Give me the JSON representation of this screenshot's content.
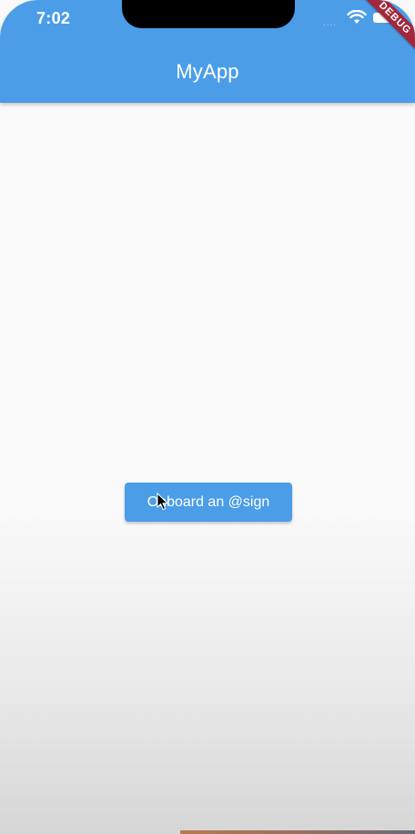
{
  "status_bar": {
    "time": "7:02",
    "icons": [
      "signal-dots-icon",
      "wifi-icon",
      "battery-icon"
    ]
  },
  "debug_banner": {
    "label": "DEBUG"
  },
  "app_bar": {
    "title": "MyApp",
    "color": "#4b9de8"
  },
  "main": {
    "onboard_button_label": "Onboard an @sign"
  },
  "colors": {
    "accent": "#4b9de8",
    "background": "#fafafa",
    "debug_banner": "#a0283a"
  }
}
